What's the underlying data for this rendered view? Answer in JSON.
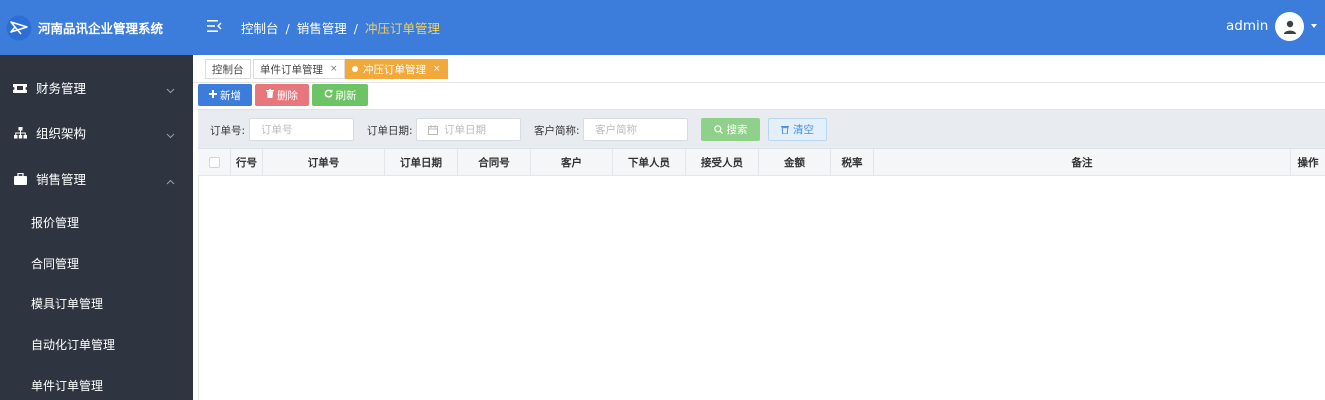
{
  "app": {
    "title": "河南品讯企业管理系统",
    "colors": {
      "header": "#3c7ddb",
      "sidebar": "#2f3540",
      "accent_tab": "#f0a93a",
      "breadcrumb_current": "#f5d15a"
    }
  },
  "header": {
    "breadcrumb": [
      "控制台",
      "销售管理",
      "冲压订单管理"
    ],
    "breadcrumb_sep": "/",
    "user": "admin"
  },
  "sidebar": {
    "groups": [
      {
        "label": "财务管理",
        "icon": "ticket-icon",
        "expanded": false
      },
      {
        "label": "组织架构",
        "icon": "sitemap-icon",
        "expanded": false
      },
      {
        "label": "销售管理",
        "icon": "briefcase-icon",
        "expanded": true
      }
    ],
    "subitems": [
      "报价管理",
      "合同管理",
      "模具订单管理",
      "自动化订单管理",
      "单件订单管理"
    ]
  },
  "tabs": [
    {
      "label": "控制台",
      "closable": false,
      "active": false
    },
    {
      "label": "单件订单管理",
      "closable": true,
      "active": false
    },
    {
      "label": "冲压订单管理",
      "closable": true,
      "active": true
    }
  ],
  "tab_close_glyph": "×",
  "toolbar": {
    "add": {
      "label": "新增",
      "color": "#3c7ddb"
    },
    "delete": {
      "label": "删除",
      "color": "#e8777d"
    },
    "refresh": {
      "label": "刷新",
      "color": "#6cc464"
    }
  },
  "search": {
    "order_no": {
      "label": "订单号:",
      "placeholder": "订单号"
    },
    "order_date": {
      "label": "订单日期:",
      "placeholder": "订单日期"
    },
    "customer": {
      "label": "客户简称:",
      "placeholder": "客户简称"
    },
    "search_btn": {
      "label": "搜索",
      "color": "#8fd08a"
    },
    "clear_btn": {
      "label": "清空",
      "color": "#4a90e2"
    }
  },
  "table": {
    "columns": [
      "行号",
      "订单号",
      "订单日期",
      "合同号",
      "客户",
      "下单人员",
      "接受人员",
      "金额",
      "税率",
      "备注",
      "操作"
    ],
    "rows": []
  }
}
